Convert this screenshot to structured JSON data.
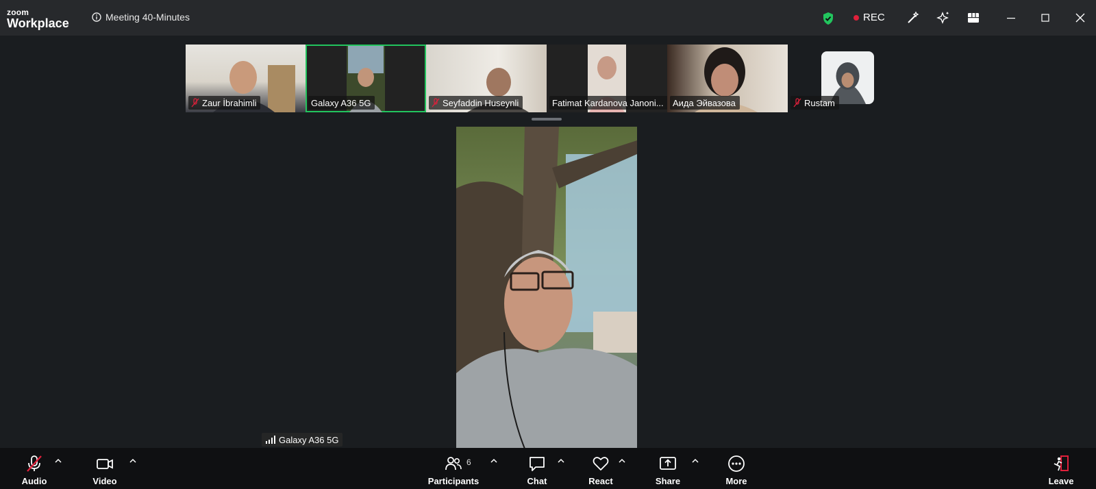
{
  "app": {
    "brand_top": "zoom",
    "brand_bottom": "Workplace",
    "meeting_title": "Meeting 40-Minutes",
    "rec_label": "REC"
  },
  "colors": {
    "accent_green": "#22c55e",
    "rec_red": "#e0203b",
    "toolbar_bg": "#0f1012",
    "titlebar_bg": "#27292c"
  },
  "participants": [
    {
      "name": "Zaur İbrahimli",
      "muted": true
    },
    {
      "name": "Galaxy A36 5G",
      "muted": false,
      "active": true
    },
    {
      "name": "Seyfaddin Huseynli",
      "muted": true
    },
    {
      "name": "Fatimat Kardanova Janoni...",
      "muted": false
    },
    {
      "name": "Аида Эйвазова",
      "muted": false
    },
    {
      "name": "Rustam",
      "muted": true
    }
  ],
  "main_video": {
    "name": "Galaxy A36 5G"
  },
  "toolbar": {
    "audio": "Audio",
    "video": "Video",
    "participants": "Participants",
    "participants_count": "6",
    "chat": "Chat",
    "react": "React",
    "share": "Share",
    "more": "More",
    "leave": "Leave"
  },
  "icons": [
    "info-icon",
    "shield-icon",
    "magic-wand-icon",
    "sparkle-icon",
    "grid-icon",
    "minimize-icon",
    "maximize-icon",
    "close-icon",
    "mic-off-icon",
    "camera-icon",
    "participants-icon",
    "chat-icon",
    "heart-icon",
    "share-icon",
    "more-icon",
    "leave-icon",
    "signal-icon"
  ]
}
